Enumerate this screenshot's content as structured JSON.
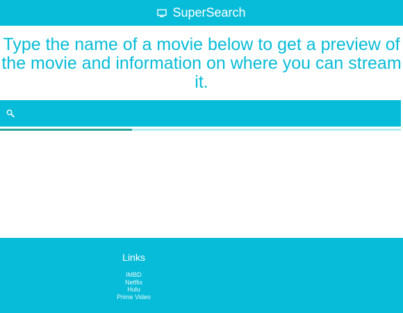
{
  "navbar": {
    "brand_icon": "desktop-icon",
    "brand_label": "SuperSearch"
  },
  "hero": {
    "headline": "Type the name of a movie below to get a preview of the movie and information on where you can stream it."
  },
  "search": {
    "icon": "search-icon",
    "value": "",
    "placeholder": ""
  },
  "progress": {
    "value_fraction": 0.33
  },
  "footer": {
    "title": "Links",
    "links": [
      {
        "label": "IMBD"
      },
      {
        "label": "Netflix"
      },
      {
        "label": "Hulu"
      },
      {
        "label": "Prime Video"
      }
    ]
  },
  "colors": {
    "primary": "#07bcd8",
    "progress_fill": "#26a69a",
    "progress_track": "#b2ebf2",
    "background": "#ffffff"
  }
}
